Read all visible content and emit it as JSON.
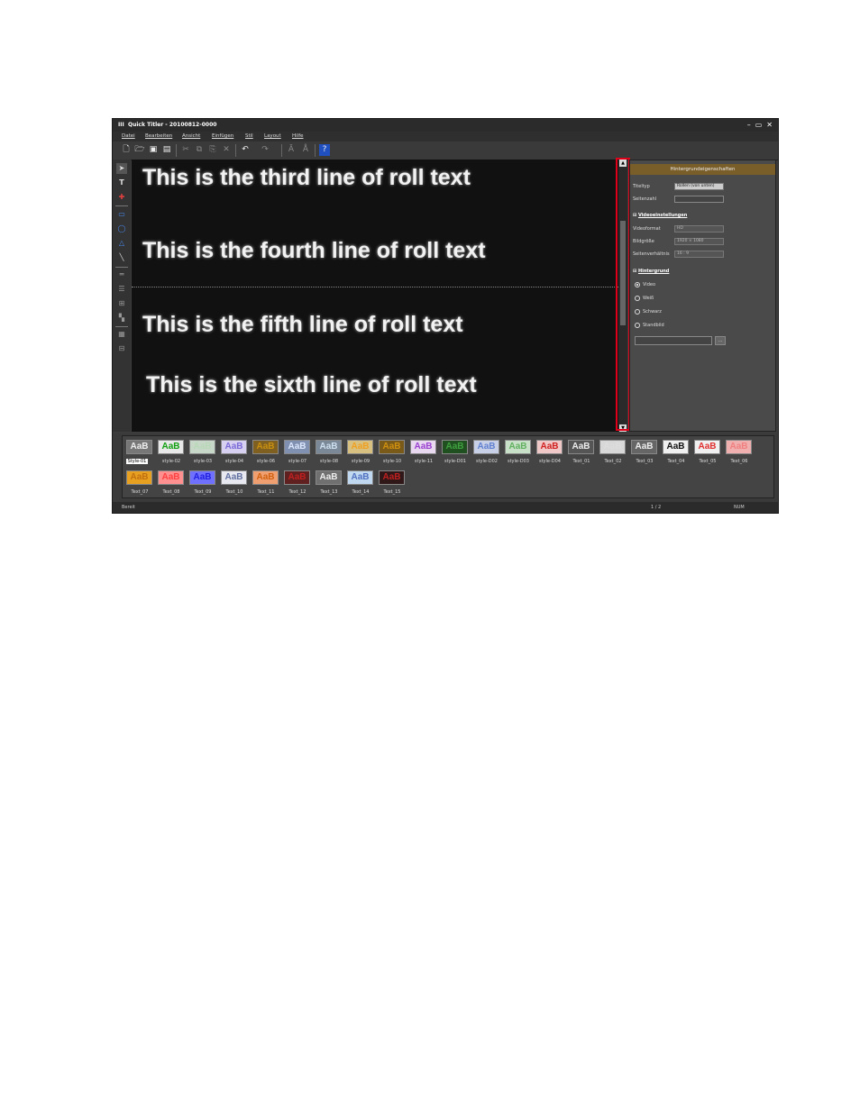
{
  "window": {
    "logo": "III",
    "title": "Quick Titler - 20100812-0000",
    "min": "–",
    "max": "▭",
    "close": "✕"
  },
  "menu": [
    "Datei",
    "Bearbeiten",
    "Ansicht",
    "Einfügen",
    "Stil",
    "Layout",
    "Hilfe"
  ],
  "canvas": {
    "lines": [
      "This is the third line of roll text",
      "This is the fourth line of roll text",
      "This is the fifth line of roll text",
      "This is the sixth line of roll text"
    ]
  },
  "panel": {
    "header": "Hintergrundeigenschaften",
    "titeltyp_label": "Titeltyp",
    "titeltyp_value": "Rollen (von unten)",
    "seitenzahl_label": "Seitenzahl",
    "video_section": "Videoeinstellungen",
    "videoformat_label": "Videoformat",
    "videoformat_value": "HD",
    "bildgroesse_label": "Bildgröße",
    "bildgroesse_value": "1920 × 1080",
    "seitenverhaeltnis_label": "Seitenverhältnis",
    "seitenverhaeltnis_value": "16 : 9",
    "bg_section": "Hintergrund",
    "radios": [
      "Video",
      "Weiß",
      "Schwarz",
      "Standbild"
    ],
    "browse": "..."
  },
  "styles": [
    {
      "name": "Style-01",
      "fg": "#eeeeee",
      "bg": "#777777",
      "selected": true
    },
    {
      "name": "style-02",
      "fg": "#10a010",
      "bg": "#e8e8e8"
    },
    {
      "name": "style-03",
      "fg": "#b8d8b8",
      "bg": "#c8d8c8"
    },
    {
      "name": "style-04",
      "fg": "#7a6ad8",
      "bg": "#d8d0f0"
    },
    {
      "name": "style-06",
      "fg": "#c89010",
      "bg": "#806020"
    },
    {
      "name": "style-07",
      "fg": "#dde8ff",
      "bg": "#8090b0"
    },
    {
      "name": "style-08",
      "fg": "#cfe0f0",
      "bg": "#7a8898"
    },
    {
      "name": "style-09",
      "fg": "#f0a020",
      "bg": "#d8c080"
    },
    {
      "name": "style-10",
      "fg": "#d09010",
      "bg": "#7a5a18"
    },
    {
      "name": "style-11",
      "fg": "#9a40d0",
      "bg": "#e8d8f0"
    },
    {
      "name": "style-D01",
      "fg": "#40a040",
      "bg": "#205020"
    },
    {
      "name": "style-D02",
      "fg": "#6080d0",
      "bg": "#c8d0e8"
    },
    {
      "name": "style-D03",
      "fg": "#60b060",
      "bg": "#c8e0c8"
    },
    {
      "name": "style-D04",
      "fg": "#d02020",
      "bg": "#f0c8c8"
    },
    {
      "name": "Text_01",
      "fg": "#eeeeee",
      "bg": "#555555"
    },
    {
      "name": "Text_02",
      "fg": "#dddddd",
      "bg": "#d8d8d8"
    },
    {
      "name": "Text_03",
      "fg": "#eeeeee",
      "bg": "#666666"
    },
    {
      "name": "Text_04",
      "fg": "#111111",
      "bg": "#f0f0f0"
    },
    {
      "name": "Text_05",
      "fg": "#e03030",
      "bg": "#f0f0f0"
    },
    {
      "name": "Text_06",
      "fg": "#f08080",
      "bg": "#f0b0b0"
    },
    {
      "name": "Text_07",
      "fg": "#c07010",
      "bg": "#e8a020"
    },
    {
      "name": "Text_08",
      "fg": "#ff4040",
      "bg": "#ff9090"
    },
    {
      "name": "Text_09",
      "fg": "#2020e0",
      "bg": "#7070ff"
    },
    {
      "name": "Text_10",
      "fg": "#6070a0",
      "bg": "#e8e8f0"
    },
    {
      "name": "Text_11",
      "fg": "#d06010",
      "bg": "#f0a070"
    },
    {
      "name": "Text_12",
      "fg": "#c02020",
      "bg": "#602020"
    },
    {
      "name": "Text_13",
      "fg": "#eeeeee",
      "bg": "#707070"
    },
    {
      "name": "Text_14",
      "fg": "#5070c0",
      "bg": "#c0d8f0"
    },
    {
      "name": "Text_15",
      "fg": "#c02020",
      "bg": "#301818"
    }
  ],
  "status": {
    "left": "Bereit",
    "page": "1 / 2",
    "num": "NUM"
  }
}
